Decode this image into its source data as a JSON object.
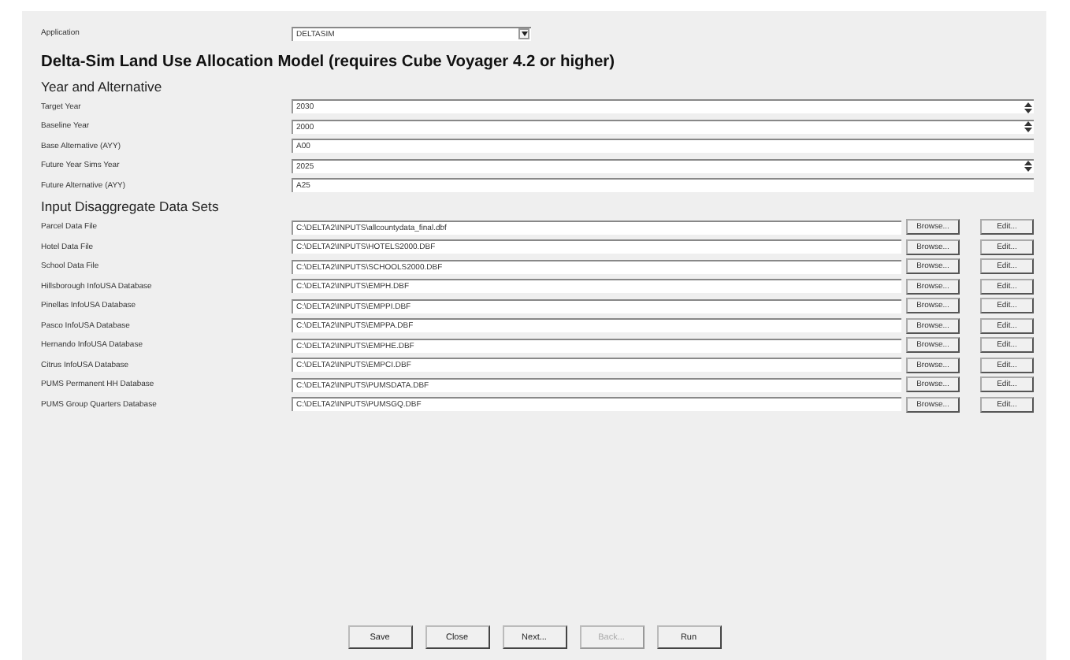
{
  "application": {
    "label": "Application",
    "value": "DELTASIM"
  },
  "title": "Delta-Sim Land Use Allocation Model (requires Cube Voyager 4.2 or higher)",
  "year_section": {
    "heading": "Year and Alternative",
    "fields": [
      {
        "label": "Target Year",
        "value": "2030",
        "kind": "spinner"
      },
      {
        "label": "Baseline Year",
        "value": "2000",
        "kind": "spinner"
      },
      {
        "label": "Base Alternative (AYY)",
        "value": "A00",
        "kind": "text"
      },
      {
        "label": "Future Year Sims Year",
        "value": "2025",
        "kind": "spinner"
      },
      {
        "label": "Future Alternative (AYY)",
        "value": "A25",
        "kind": "text"
      }
    ]
  },
  "data_section": {
    "heading": "Input Disaggregate Data Sets",
    "rows": [
      {
        "label": "Parcel Data File",
        "value": "C:\\DELTA2\\INPUTS\\allcountydata_final.dbf",
        "browse": "Browse...",
        "edit": "Edit..."
      },
      {
        "label": "Hotel Data File",
        "value": "C:\\DELTA2\\INPUTS\\HOTELS2000.DBF",
        "browse": "Browse...",
        "edit": "Edit..."
      },
      {
        "label": "School Data File",
        "value": "C:\\DELTA2\\INPUTS\\SCHOOLS2000.DBF",
        "browse": "Browse...",
        "edit": "Edit..."
      },
      {
        "label": "Hillsborough InfoUSA Database",
        "value": "C:\\DELTA2\\INPUTS\\EMPH.DBF",
        "browse": "Browse...",
        "edit": "Edit..."
      },
      {
        "label": "Pinellas InfoUSA Database",
        "value": "C:\\DELTA2\\INPUTS\\EMPPI.DBF",
        "browse": "Browse...",
        "edit": "Edit..."
      },
      {
        "label": "Pasco InfoUSA Database",
        "value": "C:\\DELTA2\\INPUTS\\EMPPA.DBF",
        "browse": "Browse...",
        "edit": "Edit..."
      },
      {
        "label": "Hernando InfoUSA Database",
        "value": "C:\\DELTA2\\INPUTS\\EMPHE.DBF",
        "browse": "Browse...",
        "edit": "Edit..."
      },
      {
        "label": "Citrus InfoUSA Database",
        "value": "C:\\DELTA2\\INPUTS\\EMPCI.DBF",
        "browse": "Browse...",
        "edit": "Edit..."
      },
      {
        "label": "PUMS Permanent HH Database",
        "value": "C:\\DELTA2\\INPUTS\\PUMSDATA.DBF",
        "browse": "Browse...",
        "edit": "Edit..."
      },
      {
        "label": "PUMS Group Quarters Database",
        "value": "C:\\DELTA2\\INPUTS\\PUMSGQ.DBF",
        "browse": "Browse...",
        "edit": "Edit..."
      }
    ]
  },
  "buttons": [
    {
      "label": "Save",
      "disabled": false
    },
    {
      "label": "Close",
      "disabled": false
    },
    {
      "label": "Next...",
      "disabled": false
    },
    {
      "label": "Back...",
      "disabled": true
    },
    {
      "label": "Run",
      "disabled": false
    }
  ]
}
